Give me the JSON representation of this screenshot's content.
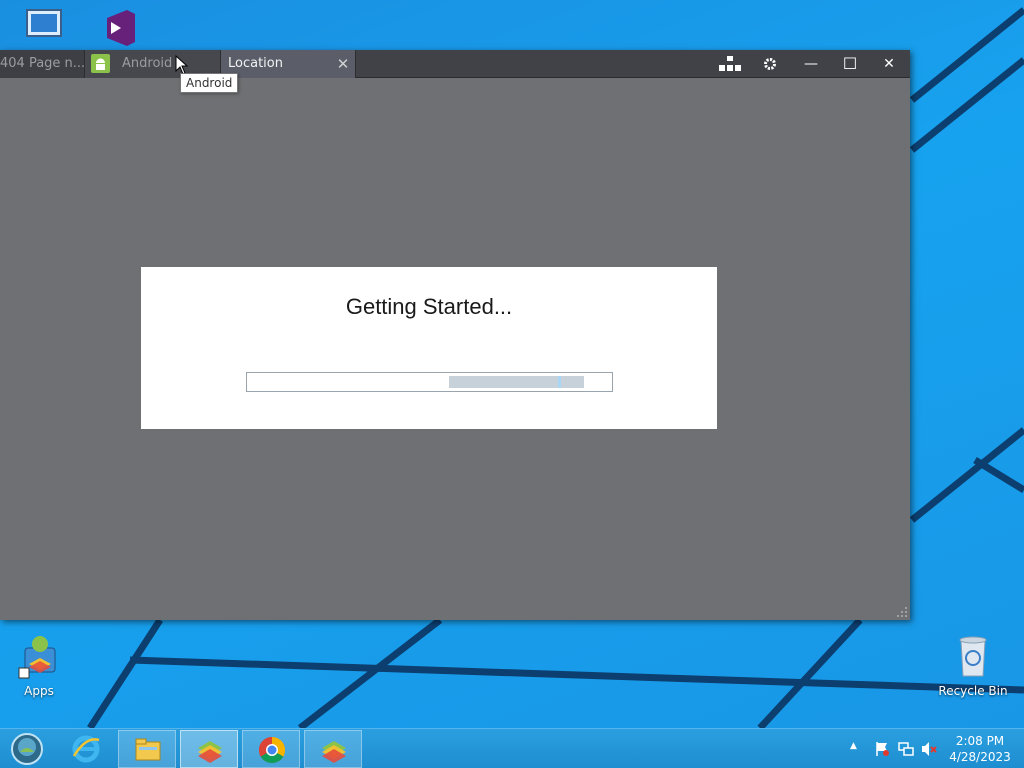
{
  "window": {
    "tabs": [
      {
        "label": "404 Page n..."
      },
      {
        "label": "Android"
      },
      {
        "label": "Location",
        "close_glyph": "✕"
      }
    ],
    "tooltip": "Android",
    "controls": {
      "keymap_icon": "keymap-icon",
      "settings_icon": "gear-icon",
      "minimize_glyph": "—",
      "maximize_glyph": "☐",
      "close_glyph": "✕"
    }
  },
  "dialog": {
    "title": "Getting Started...",
    "progress_fraction": 0.37
  },
  "desktop": {
    "icons": [
      {
        "label": "Apps"
      },
      {
        "label": "Recycle Bin"
      }
    ]
  },
  "taskbar": {
    "clock_time": "2:08 PM",
    "clock_date": "4/28/2023",
    "tray_chevron": "▲"
  },
  "colors": {
    "desktop_blue": "#1a8fe0",
    "window_body": "#6f7073",
    "titlebar": "#404248",
    "active_tab": "#5b5e69",
    "android_green": "#8bc34a"
  }
}
